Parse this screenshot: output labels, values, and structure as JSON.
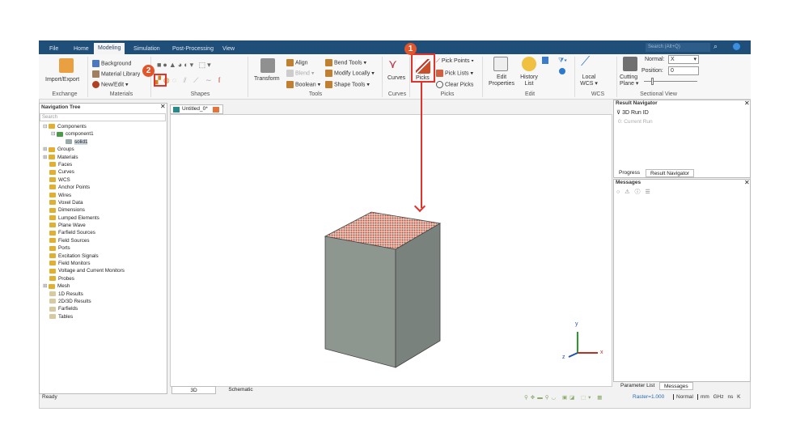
{
  "menu_tabs": [
    "File",
    "Home",
    "Modeling",
    "Simulation",
    "Post-Processing",
    "View"
  ],
  "active_tab": "Modeling",
  "search_placeholder": "Search (Alt+Q)",
  "ribbon": {
    "exchange": {
      "import_export": "Import/Export",
      "group": "Exchange"
    },
    "materials": {
      "background": "Background",
      "library": "Material Library",
      "new_edit": "New/Edit",
      "group": "Materials"
    },
    "shapes": {
      "group": "Shapes"
    },
    "tools": {
      "transform": "Transform",
      "align": "Align",
      "blend": "Blend",
      "boolean": "Boolean",
      "bend_tools": "Bend Tools",
      "modify_locally": "Modify Locally",
      "shape_tools": "Shape Tools",
      "group": "Tools"
    },
    "curves": {
      "curves": "Curves",
      "group": "Curves"
    },
    "picks": {
      "picks": "Picks",
      "pick_points": "Pick Points",
      "pick_lists": "Pick Lists",
      "clear_picks": "Clear Picks",
      "group": "Picks"
    },
    "edit": {
      "edit_properties_1": "Edit",
      "edit_properties_2": "Properties",
      "history_1": "History",
      "history_2": "List",
      "group": "Edit"
    },
    "wcs": {
      "local_1": "Local",
      "local_2": "WCS",
      "group": "WCS"
    },
    "sectional": {
      "cutting_1": "Cutting",
      "cutting_2": "Plane",
      "normal_label": "Normal:",
      "normal_value": "X",
      "position_label": "Position:",
      "position_value": "0",
      "group": "Sectional View"
    }
  },
  "nav_tree": {
    "title": "Navigation Tree",
    "search_placeholder": "Search",
    "items": [
      "Components",
      "component1",
      "solid1",
      "Groups",
      "Materials",
      "Faces",
      "Curves",
      "WCS",
      "Anchor Points",
      "Wires",
      "Voxel Data",
      "Dimensions",
      "Lumped Elements",
      "Plane Wave",
      "Farfield Sources",
      "Field Sources",
      "Ports",
      "Excitation Signals",
      "Field Monitors",
      "Voltage and Current Monitors",
      "Probes",
      "Mesh",
      "1D Results",
      "2D/3D Results",
      "Farfields",
      "Tables"
    ]
  },
  "doc_tab": "Untitled_0*",
  "view_tabs": [
    "3D",
    "Schematic"
  ],
  "axes": {
    "x": "x",
    "y": "y",
    "z": "z"
  },
  "result_nav": {
    "title": "Result Navigator",
    "run_id": "3D Run ID",
    "current_run": "0: Current Run",
    "tabs": [
      "Progress",
      "Result Navigator"
    ]
  },
  "messages": {
    "title": "Messages",
    "tabs": [
      "Parameter List",
      "Messages"
    ]
  },
  "status": {
    "ready": "Ready",
    "raster": "Raster=1.000",
    "mode": "Normal",
    "units": [
      "mm",
      "GHz",
      "ns",
      "K"
    ]
  },
  "annotations": [
    "1",
    "2"
  ],
  "colors": {
    "accent": "#1f4e79",
    "annotation": "#e0332b"
  }
}
